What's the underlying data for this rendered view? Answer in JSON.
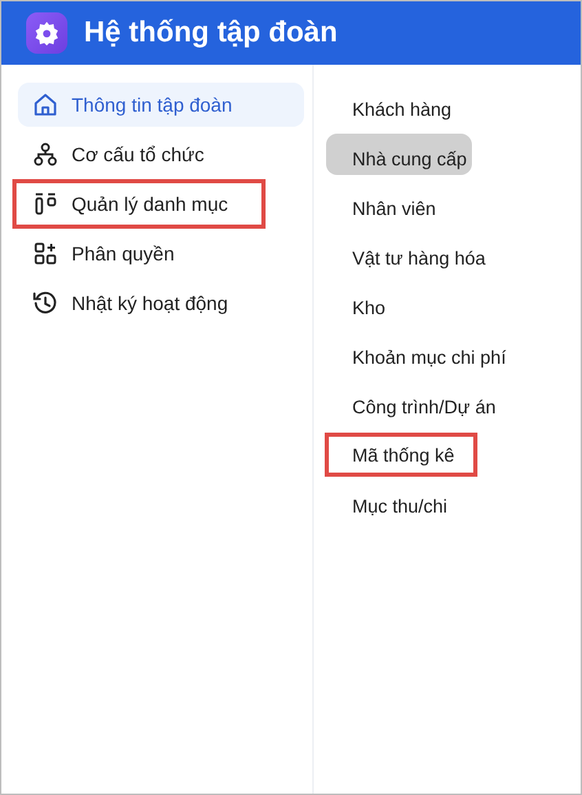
{
  "header": {
    "title": "Hệ thống tập đoàn"
  },
  "menu": [
    {
      "label": "Thông tin tập đoàn",
      "selected": true,
      "highlighted": false
    },
    {
      "label": "Cơ cấu tổ chức",
      "selected": false,
      "highlighted": false
    },
    {
      "label": "Quản lý danh mục",
      "selected": false,
      "highlighted": true
    },
    {
      "label": "Phân quyền",
      "selected": false,
      "highlighted": false
    },
    {
      "label": "Nhật ký hoạt động",
      "selected": false,
      "highlighted": false
    }
  ],
  "submenu": [
    {
      "label": "Khách hàng",
      "highlighted": false
    },
    {
      "label": "Nhà cung cấp",
      "highlighted": false
    },
    {
      "label": "Nhân viên",
      "highlighted": false
    },
    {
      "label": "Vật tư hàng hóa",
      "highlighted": false
    },
    {
      "label": "Kho",
      "highlighted": false
    },
    {
      "label": "Khoản mục chi phí",
      "highlighted": false
    },
    {
      "label": "Công trình/Dự án",
      "highlighted": false
    },
    {
      "label": "Mã thống kê",
      "highlighted": true
    },
    {
      "label": "Mục thu/chi",
      "highlighted": false
    }
  ]
}
